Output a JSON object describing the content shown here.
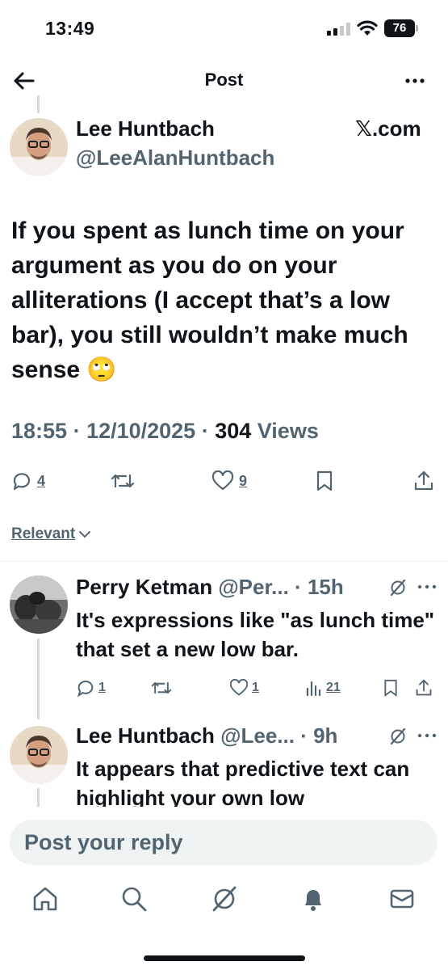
{
  "status_bar": {
    "time": "13:49",
    "battery": "76"
  },
  "nav": {
    "title": "Post"
  },
  "post": {
    "author_name": "Lee Huntbach",
    "author_handle": "@LeeAlanHuntbach",
    "source": "𝕏.com",
    "text": "If you spent as lunch time on your argument as you do on your alliterations (I accept that’s a low bar), you still wouldn’t make much sense 🙄",
    "time": "18:55",
    "date": "12/10/2025",
    "views_count": "304",
    "views_label": "Views",
    "replies": "4",
    "likes": "9"
  },
  "sort": {
    "label": "Relevant"
  },
  "replies": [
    {
      "name": "Perry Ketman",
      "handle": "@Per...",
      "age": "15h",
      "text": "It's expressions like \"as lunch time\" that set a new low bar.",
      "replies": "1",
      "likes": "1",
      "views": "21"
    },
    {
      "name": "Lee Huntbach",
      "handle": "@Lee...",
      "age": "9h",
      "text": "It appears that predictive text can highlight your own low"
    }
  ],
  "composer": {
    "placeholder": "Post your reply"
  },
  "colors": {
    "text": "#0f1419",
    "muted": "#536471",
    "line": "#cfd9de",
    "input_bg": "#eff3f4"
  },
  "icons": [
    "back-arrow-icon",
    "more-icon",
    "reply-icon",
    "repost-icon",
    "like-icon",
    "bookmark-icon",
    "share-icon",
    "views-icon",
    "grok-icon",
    "home-icon",
    "search-icon",
    "bell-icon",
    "mail-icon"
  ]
}
